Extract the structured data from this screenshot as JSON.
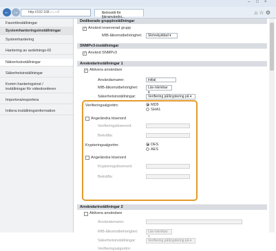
{
  "browser": {
    "address": "http://192.168.---.---/",
    "tab_title": "Grönsnitt för fjärranvändni...",
    "back_icon": "back-arrow-icon",
    "forward_icon": "forward-arrow-icon",
    "win_controls": [
      "–",
      "□",
      "×"
    ]
  },
  "sidebar": {
    "items": [
      {
        "label": "Favoritinställningar"
      },
      {
        "label": "Systemhanteringsinställningar",
        "head": true
      },
      {
        "label": "Systemhantering"
      },
      {
        "label": "Hantering av avdelnings-ID"
      },
      {
        "label": "Nätverksinställningar",
        "active": true
      },
      {
        "label": "Säkerhetsinställningar"
      },
      {
        "label": "Komm hanteringsinst /"
      },
      {
        "label": "inställningar för videokonferen"
      },
      {
        "label": "Importera/exportera"
      },
      {
        "label": "Initiera inställningsinformation"
      }
    ]
  },
  "dedicated": {
    "header": "Dedikerade gruppinställningar",
    "use_reserved": "Använd reserverad grupp",
    "mib_label": "MIB-åtkomstbehörighet:",
    "mib_value": "Skrivskyddad"
  },
  "snmpv3": {
    "header": "SNMPv3-inställningar",
    "use": "Använd SNMPv3"
  },
  "user1": {
    "header": "Användarinställningar 1",
    "activate": "Aktivera användare",
    "username_label": "Användarnamn:",
    "username_value": "initial",
    "mib_label": "MIB-åtkomstbehörighet:",
    "mib_value": "Läs-/skrivbar",
    "security_label": "Säkerhetsinställningar:",
    "security_value": "Verifiering på/kryptering på",
    "auth_label": "Verifieringsalgoritm:",
    "auth_opts": [
      "MD5",
      "SHA1"
    ],
    "set_change_pw_auth": "Ange/ändra lösenord",
    "auth_pw_label": "Verifieringslösenord:",
    "confirm_label": "Bekräfta:",
    "enc_label": "Krypteringsalgoritm:",
    "enc_opts": [
      "DES",
      "AES"
    ],
    "set_change_pw_enc": "Ange/ändra lösenord",
    "enc_pw_label": "Krypteringslösenord:",
    "confirm2_label": "Bekräfta:"
  },
  "user2": {
    "header": "Användarinställningar 2",
    "activate": "Aktivera användare",
    "username_label": "Användarnamn:",
    "mib_label": "MIB-åtkomstbehörighet:",
    "mib_value": "Läs-/skrivbar",
    "security_label": "Säkerhetsinställningar:",
    "security_value": "Verifiering på/kryptering på",
    "auth_label": "Verifieringsalgoritm:"
  }
}
